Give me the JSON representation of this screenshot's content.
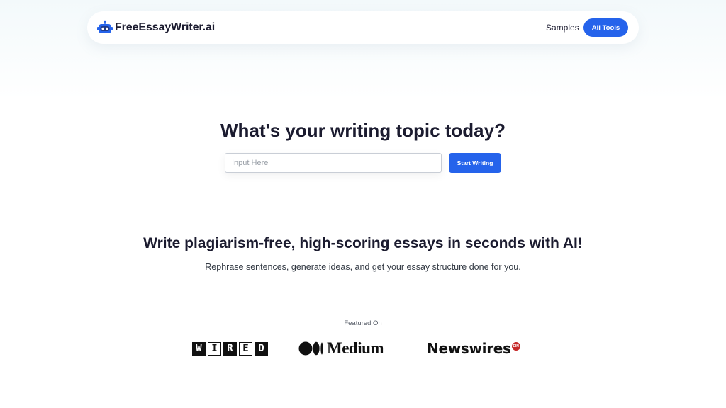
{
  "nav": {
    "brand": "FreeEssayWriter.ai",
    "samples_label": "Samples",
    "all_tools_label": "All Tools"
  },
  "hero": {
    "title": "What's your writing topic today?",
    "input_placeholder": "Input Here",
    "input_value": "",
    "start_button": "Start Writing"
  },
  "tagline": {
    "headline": "Write plagiarism-free, high-scoring essays in seconds with AI!",
    "subtext": "Rephrase sentences, generate ideas, and get your essay structure done for you."
  },
  "featured": {
    "label": "Featured On",
    "wired": [
      "W",
      "I",
      "R",
      "E",
      "D"
    ],
    "medium": "Medium",
    "newswires": "Newswires",
    "newswires_badge": "EIN"
  },
  "colors": {
    "accent": "#2563eb",
    "text": "#1b1b2f",
    "badge_red": "#c62828"
  },
  "icons": {
    "brand": "robot-icon",
    "medium": "medium-logo-icon"
  }
}
